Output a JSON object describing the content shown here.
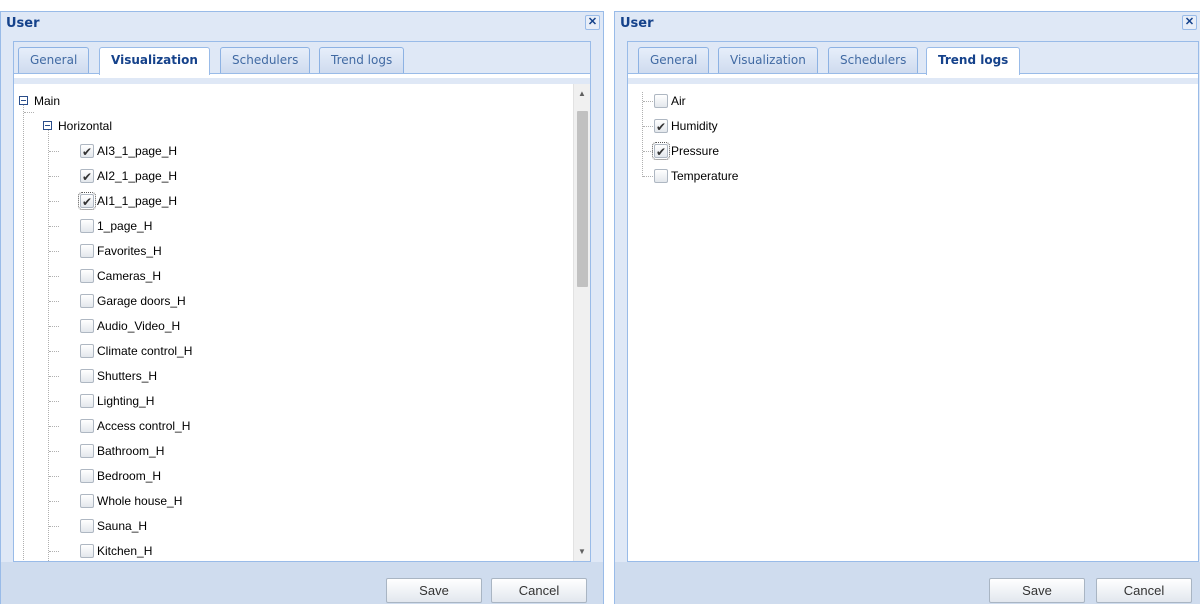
{
  "left_dialog": {
    "title": "User",
    "close_glyph": "✕",
    "tabs": [
      {
        "label": "General",
        "active": false
      },
      {
        "label": "Visualization",
        "active": true
      },
      {
        "label": "Schedulers",
        "active": false
      },
      {
        "label": "Trend logs",
        "active": false
      }
    ],
    "tree": {
      "root_label": "Main",
      "group_label": "Horizontal",
      "items": [
        {
          "label": "AI3_1_page_H",
          "checked": true
        },
        {
          "label": "AI2_1_page_H",
          "checked": true
        },
        {
          "label": "AI1_1_page_H",
          "checked": true,
          "focused": true
        },
        {
          "label": "1_page_H",
          "checked": false
        },
        {
          "label": "Favorites_H",
          "checked": false
        },
        {
          "label": "Cameras_H",
          "checked": false
        },
        {
          "label": "Garage doors_H",
          "checked": false
        },
        {
          "label": "Audio_Video_H",
          "checked": false
        },
        {
          "label": "Climate control_H",
          "checked": false
        },
        {
          "label": "Shutters_H",
          "checked": false
        },
        {
          "label": "Lighting_H",
          "checked": false
        },
        {
          "label": "Access control_H",
          "checked": false
        },
        {
          "label": "Bathroom_H",
          "checked": false
        },
        {
          "label": "Bedroom_H",
          "checked": false
        },
        {
          "label": "Whole house_H",
          "checked": false
        },
        {
          "label": "Sauna_H",
          "checked": false
        },
        {
          "label": "Kitchen_H",
          "checked": false
        }
      ]
    },
    "save_label": "Save",
    "cancel_label": "Cancel"
  },
  "right_dialog": {
    "title": "User",
    "close_glyph": "✕",
    "tabs": [
      {
        "label": "General",
        "active": false
      },
      {
        "label": "Visualization",
        "active": false
      },
      {
        "label": "Schedulers",
        "active": false
      },
      {
        "label": "Trend logs",
        "active": true
      }
    ],
    "items": [
      {
        "label": "Air",
        "checked": false
      },
      {
        "label": "Humidity",
        "checked": true
      },
      {
        "label": "Pressure",
        "checked": true,
        "focused": true
      },
      {
        "label": "Temperature",
        "checked": false
      }
    ],
    "save_label": "Save",
    "cancel_label": "Cancel"
  },
  "colors": {
    "window_bg": "#dfe8f6",
    "border": "#99bbe8",
    "title_text": "#15428b",
    "footer_bg": "#cfdcee"
  }
}
